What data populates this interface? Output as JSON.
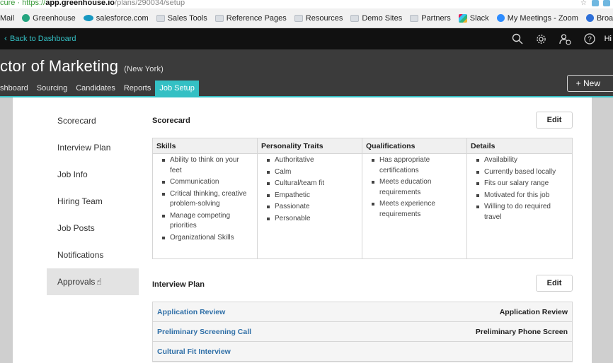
{
  "browser": {
    "url_secure_label": "cure",
    "url_scheme": "https://",
    "url_host": "app.greenhouse.io",
    "url_path": "/plans/290034/setup",
    "bookmarks": [
      {
        "label": "Mail",
        "icon": "mail-icon"
      },
      {
        "label": "Greenhouse",
        "icon": "greenhouse-icon"
      },
      {
        "label": "salesforce.com",
        "icon": "salesforce-icon"
      },
      {
        "label": "Sales Tools",
        "icon": "folder-icon"
      },
      {
        "label": "Reference Pages",
        "icon": "folder-icon"
      },
      {
        "label": "Resources",
        "icon": "folder-icon"
      },
      {
        "label": "Demo Sites",
        "icon": "folder-icon"
      },
      {
        "label": "Partners",
        "icon": "folder-icon"
      },
      {
        "label": "Slack",
        "icon": "slack-icon"
      },
      {
        "label": "My Meetings - Zoom",
        "icon": "zoom-icon"
      },
      {
        "label": "Broadway Lot",
        "icon": "broadway-icon"
      }
    ]
  },
  "topnav": {
    "back_label": "Back to Dashboard",
    "greeting": "Hi",
    "icons": [
      "search-icon",
      "gear-icon",
      "user-add-icon",
      "help-icon"
    ]
  },
  "job": {
    "title": "ctor of Marketing",
    "location": "(New York)",
    "new_button": "+ New",
    "tabs": [
      "shboard",
      "Sourcing",
      "Candidates",
      "Reports",
      "Job Setup"
    ],
    "active_tab": "Job Setup"
  },
  "sidebar": {
    "items": [
      "Scorecard",
      "Interview Plan",
      "Job Info",
      "Hiring Team",
      "Job Posts",
      "Notifications",
      "Approvals"
    ],
    "hovered": "Approvals"
  },
  "scorecard": {
    "title": "Scorecard",
    "edit_label": "Edit",
    "columns": [
      {
        "header": "Skills",
        "items": [
          "Ability to think on your feet",
          "Communication",
          "Critical thinking, creative problem-solving",
          "Manage competing priorities",
          "Organizational Skills"
        ]
      },
      {
        "header": "Personality Traits",
        "items": [
          "Authoritative",
          "Calm",
          "Cultural/team fit",
          "Empathetic",
          "Passionate",
          "Personable"
        ]
      },
      {
        "header": "Qualifications",
        "items": [
          "Has appropriate certifications",
          "Meets education requirements",
          "Meets experience requirements"
        ]
      },
      {
        "header": "Details",
        "items": [
          "Availability",
          "Currently based locally",
          "Fits our salary range",
          "Motivated for this job",
          "Willing to do required travel"
        ]
      }
    ]
  },
  "interview_plan": {
    "title": "Interview Plan",
    "edit_label": "Edit",
    "rows": [
      {
        "stage": "Application Review",
        "interview": "Application Review"
      },
      {
        "stage": "Preliminary Screening Call",
        "interview": "Preliminary Phone Screen"
      },
      {
        "stage": "Cultural Fit Interview",
        "interview": ""
      }
    ]
  },
  "colors": {
    "accent": "#34c0c4",
    "nav_bg": "#111111",
    "header_bg": "#3b3b3b",
    "link": "#2f6fa7"
  }
}
